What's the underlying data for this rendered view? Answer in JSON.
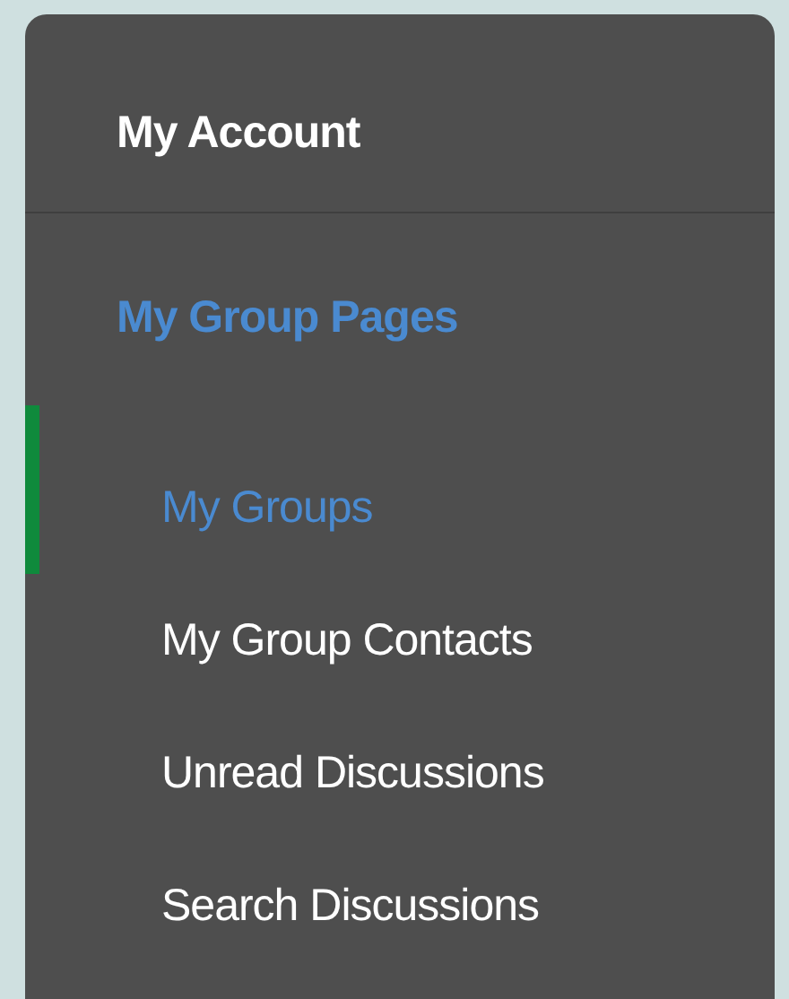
{
  "account": {
    "label": "My Account"
  },
  "group": {
    "label": "My Group Pages",
    "active": true
  },
  "items": [
    {
      "label": "My Groups",
      "selected": true
    },
    {
      "label": "My Group Contacts",
      "selected": false
    },
    {
      "label": "Unread Discussions",
      "selected": false
    },
    {
      "label": "Search Discussions",
      "selected": false
    }
  ]
}
